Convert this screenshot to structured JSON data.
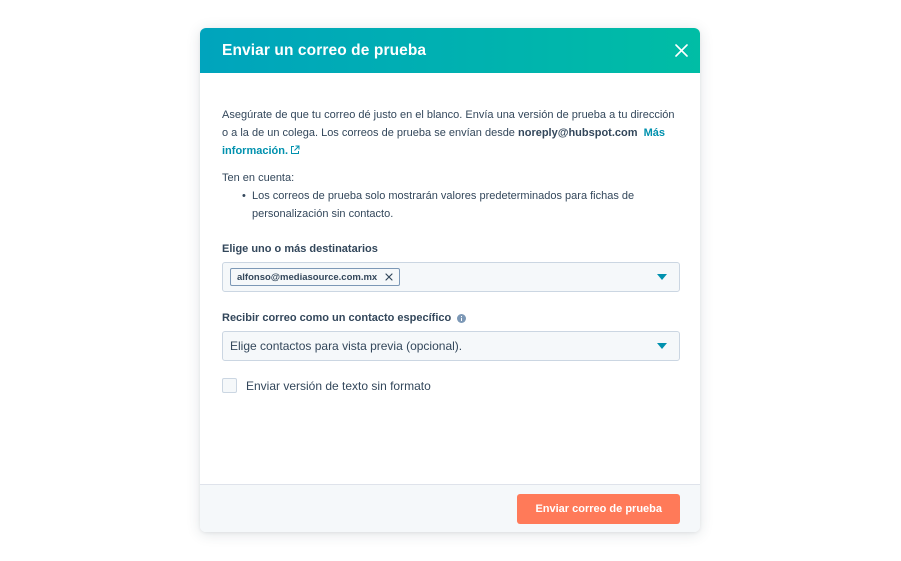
{
  "modal": {
    "title": "Enviar un correo de prueba",
    "intro": {
      "text": "Asegúrate de que tu correo dé justo en el blanco. Envía una versión de prueba a tu dirección o a la de un colega. Los correos de prueba se envían desde ",
      "sender": "noreply@hubspot.com",
      "link": "Más información."
    },
    "note": {
      "title": "Ten en cuenta:",
      "items": [
        "Los correos de prueba solo mostrarán valores predeterminados para fichas de personalización sin contacto."
      ]
    },
    "recipients": {
      "label": "Elige uno o más destinatarios",
      "chips": [
        "alfonso@mediasource.com.mx"
      ]
    },
    "contact": {
      "label": "Recibir correo como un contacto específico",
      "placeholder": "Elige contactos para vista previa (opcional)."
    },
    "plaintext": {
      "label": "Enviar versión de texto sin formato",
      "checked": false
    },
    "footer": {
      "send_label": "Enviar correo de prueba"
    }
  },
  "colors": {
    "header_start": "#00a4bd",
    "header_end": "#00bda5",
    "primary": "#ff7a59",
    "link": "#0091ae",
    "text": "#33475b"
  },
  "icons": {
    "close": "close-icon",
    "external": "external-link-icon",
    "info": "info-icon",
    "caret": "caret-down-icon",
    "chip_remove": "chip-remove-icon"
  }
}
